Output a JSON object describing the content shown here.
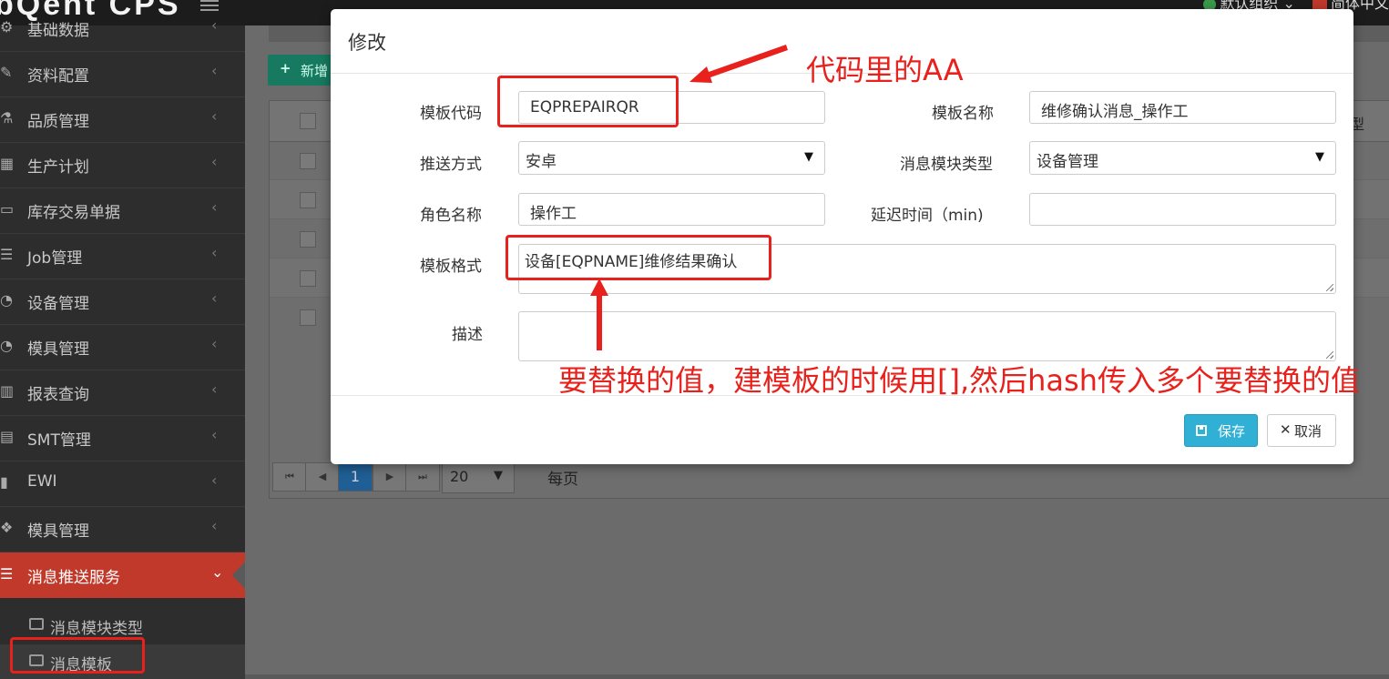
{
  "topbar": {
    "brand": "bQent CPS",
    "org": "默认组织",
    "language": "简体中文"
  },
  "sidebar": {
    "items": [
      {
        "label": "基础数据",
        "icon": "gear-icon"
      },
      {
        "label": "资料配置",
        "icon": "edit-icon"
      },
      {
        "label": "品质管理",
        "icon": "flask-icon"
      },
      {
        "label": "生产计划",
        "icon": "calendar-icon"
      },
      {
        "label": "库存交易单据",
        "icon": "monitor-icon"
      },
      {
        "label": "Job管理",
        "icon": "server-icon"
      },
      {
        "label": "设备管理",
        "icon": "dashboard-icon"
      },
      {
        "label": "模具管理",
        "icon": "dashboard-icon"
      },
      {
        "label": "报表查询",
        "icon": "bar-chart-icon"
      },
      {
        "label": "SMT管理",
        "icon": "chip-icon"
      },
      {
        "label": "EWI",
        "icon": "file-icon"
      },
      {
        "label": "模具管理",
        "icon": "cubes-icon"
      },
      {
        "label": "消息推送服务",
        "icon": "server-icon"
      }
    ],
    "subitems": [
      {
        "label": "消息模块类型",
        "icon": "camera-icon"
      },
      {
        "label": "消息模板",
        "icon": "camera-icon"
      }
    ]
  },
  "main": {
    "add_label": "新增",
    "header_tail": "型",
    "pager": {
      "current_page": "1",
      "page_size": "20",
      "per_page_label": "每页"
    }
  },
  "modal": {
    "title": "修改",
    "fields": {
      "template_code": {
        "label": "模板代码",
        "value": "EQPREPAIRQR"
      },
      "template_name": {
        "label": "模板名称",
        "value": "维修确认消息_操作工"
      },
      "push_method": {
        "label": "推送方式",
        "value": "安卓"
      },
      "module_type": {
        "label": "消息模块类型",
        "value": "设备管理"
      },
      "role_name": {
        "label": "角色名称",
        "value": "操作工"
      },
      "delay": {
        "label": "延迟时间（min)",
        "value": ""
      },
      "template_format": {
        "label": "模板格式",
        "value": "设备[EQPNAME]维修结果确认"
      },
      "description": {
        "label": "描述",
        "value": ""
      }
    },
    "save_label": "保存",
    "cancel_label": "取消"
  },
  "annotations": {
    "code_note": "代码里的AA",
    "format_note": "要替换的值，建模板的时候用[],然后hash传入多个要替换的值",
    "color": "#e8211c"
  },
  "colors": {
    "sidebar_active": "#c0392b",
    "save_button": "#31b0d5",
    "add_button": "#17795f",
    "current_page": "#1f5f95"
  }
}
